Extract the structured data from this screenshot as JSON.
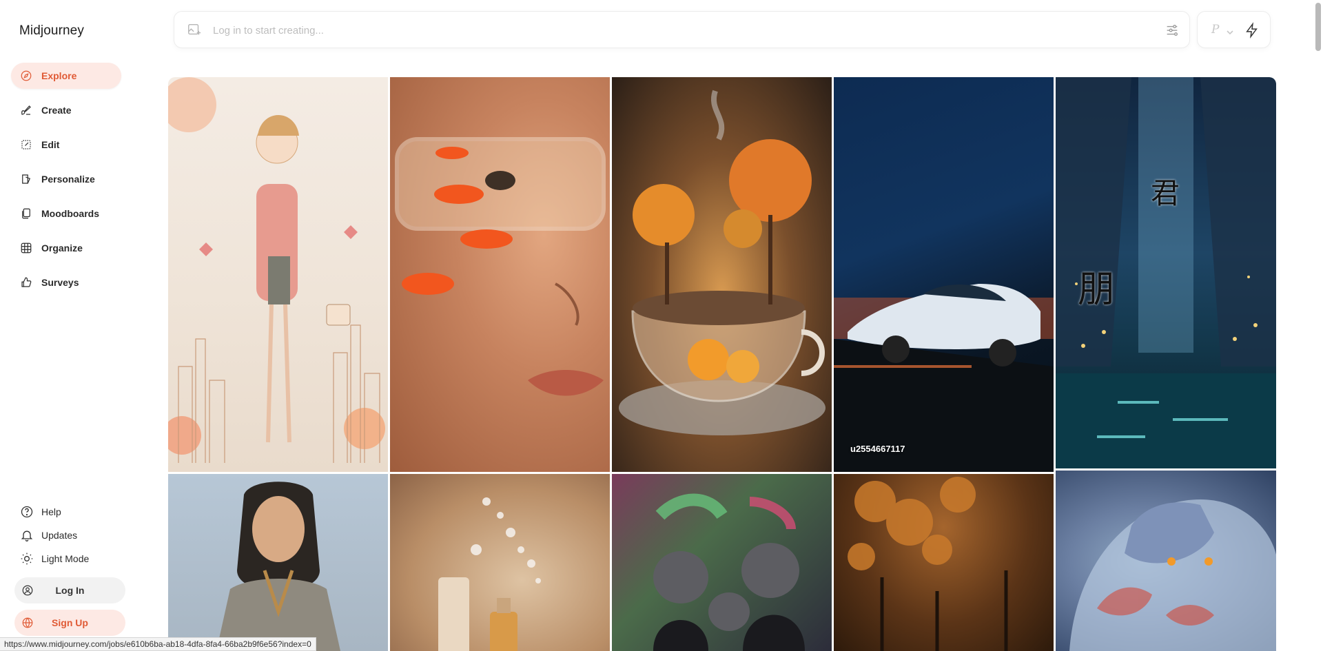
{
  "brand": {
    "name": "Midjourney"
  },
  "nav": {
    "items": [
      {
        "label": "Explore",
        "icon": "compass-icon",
        "active": true
      },
      {
        "label": "Create",
        "icon": "brush-icon"
      },
      {
        "label": "Edit",
        "icon": "edit-icon"
      },
      {
        "label": "Personalize",
        "icon": "personalize-icon"
      },
      {
        "label": "Moodboards",
        "icon": "moodboards-icon"
      },
      {
        "label": "Organize",
        "icon": "grid-icon"
      },
      {
        "label": "Surveys",
        "icon": "thumbs-up-icon"
      }
    ]
  },
  "bottom_nav": {
    "items": [
      {
        "label": "Help",
        "icon": "help-circle-icon"
      },
      {
        "label": "Updates",
        "icon": "bell-icon"
      },
      {
        "label": "Light Mode",
        "icon": "sun-icon"
      }
    ]
  },
  "auth": {
    "login_label": "Log In",
    "signup_label": "Sign Up"
  },
  "search": {
    "placeholder": "Log in to start creating..."
  },
  "mode": {
    "letter": "P"
  },
  "gallery": {
    "tiles": [
      {
        "caption": "",
        "kanji": []
      },
      {
        "caption": "",
        "kanji": []
      },
      {
        "caption": "",
        "kanji": []
      },
      {
        "caption": "u2554667117",
        "kanji": []
      },
      {
        "caption": "",
        "kanji": [
          "君",
          "朋"
        ]
      },
      {
        "caption": "",
        "kanji": []
      },
      {
        "caption": "",
        "kanji": []
      },
      {
        "caption": "",
        "kanji": []
      },
      {
        "caption": "",
        "kanji": []
      },
      {
        "caption": "",
        "kanji": []
      }
    ]
  },
  "status_url": "https://www.midjourney.com/jobs/e610b6ba-ab18-4dfa-8fa4-66ba2b9f6e56?index=0",
  "colors": {
    "accent": "#e05a35",
    "accent_bg": "#fde9e4"
  }
}
